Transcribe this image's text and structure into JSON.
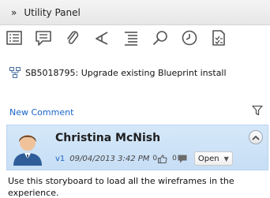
{
  "header": {
    "collapse_glyph": "»",
    "title": "Utility Panel"
  },
  "toolbar": {
    "icons": [
      "details-icon",
      "comments-icon",
      "attachments-icon",
      "share-icon",
      "outline-icon",
      "search-icon",
      "history-icon",
      "review-icon"
    ]
  },
  "storyboard": {
    "icon": "storyboard-icon",
    "title": "SB5018795: Upgrade existing Blueprint install"
  },
  "comments": {
    "new_comment_label": "New Comment",
    "items": [
      {
        "author": "Christina McNish",
        "version": "v1",
        "date": "09/04/2013 3:42 PM",
        "likes": "0",
        "replies": "0",
        "status": "Open",
        "body": "Use this storyboard to load all the wireframes in the experience."
      }
    ]
  },
  "colors": {
    "link": "#1a64c8",
    "card_bg": "#cfe3f7",
    "header_bg": "#ececec"
  }
}
